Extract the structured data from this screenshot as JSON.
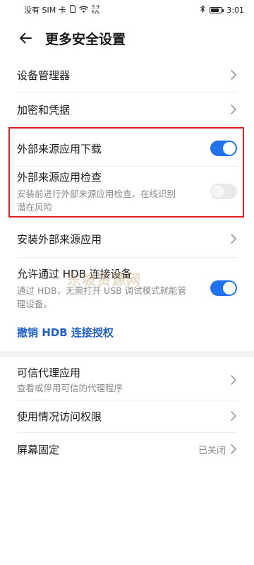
{
  "status_bar": {
    "carrier": "没有 SIM 卡",
    "net_speed_value": "3.9",
    "net_speed_unit": "K/s",
    "time": "3:01"
  },
  "header": {
    "title": "更多安全设置"
  },
  "items": {
    "device_manager": "设备管理器",
    "encryption": "加密和凭据",
    "external_download": {
      "title": "外部来源应用下载",
      "enabled": true
    },
    "external_check": {
      "title": "外部来源应用检查",
      "subtitle_line1": "安装前进行外部来源应用检查，在线识别",
      "subtitle_line2": "潜在风险",
      "enabled": false
    },
    "install_external": "安装外部来源应用",
    "hdb": {
      "title": "允许通过 HDB 连接设备",
      "subtitle_line1": "通过 HDB，无需打开 USB 调试模式就能管",
      "subtitle_line2": "理设备。",
      "enabled": true
    },
    "revoke_hdb": "撤销 HDB 连接授权",
    "trusted_agent": {
      "title": "可信代理应用",
      "subtitle": "查看或停用可信的代理程序"
    },
    "usage_access": "使用情况访问权限",
    "screen_pinning": {
      "title": "屏幕固定",
      "value": "已关闭"
    }
  },
  "watermark": "东坡资源网",
  "colors": {
    "accent": "#1f73f1",
    "link": "#1f5fcf",
    "highlight_border": "#e02020"
  }
}
